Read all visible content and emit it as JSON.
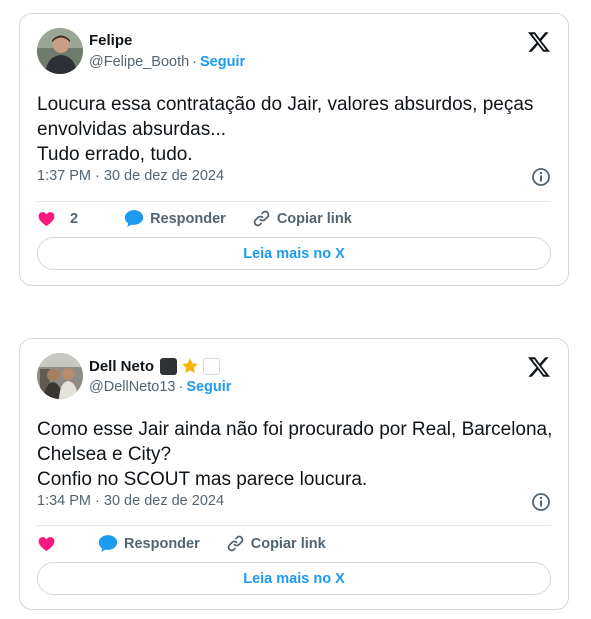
{
  "tweets": [
    {
      "name": "Felipe",
      "handle": "@Felipe_Booth",
      "separator": "·",
      "follow_label": "Seguir",
      "text": "Loucura essa contratação do Jair, valores absurdos, peças envolvidas absurdas...\nTudo errado, tudo.",
      "timestamp": "1:37 PM · 30 de dez de 2024",
      "like_count": "2",
      "reply_label": "Responder",
      "copy_label": "Copiar link",
      "read_more_label": "Leia mais no X"
    },
    {
      "name": "Dell Neto",
      "handle": "@DellNeto13",
      "separator": "·",
      "follow_label": "Seguir",
      "text": "Como esse Jair ainda não foi procurado por Real, Barcelona, Chelsea e City?\nConfio no SCOUT mas parece loucura.",
      "timestamp": "1:34 PM · 30 de dez de 2024",
      "reply_label": "Responder",
      "copy_label": "Copiar link",
      "read_more_label": "Leia mais no X"
    }
  ],
  "icons": {
    "like": "heart-icon",
    "reply": "speech-bubble-icon",
    "copy": "link-icon",
    "info": "info-icon",
    "logo": "x-logo-icon"
  },
  "colors": {
    "accent": "#1d9bf0",
    "like": "#f91880",
    "muted": "#536471",
    "border": "#cfd9de"
  }
}
